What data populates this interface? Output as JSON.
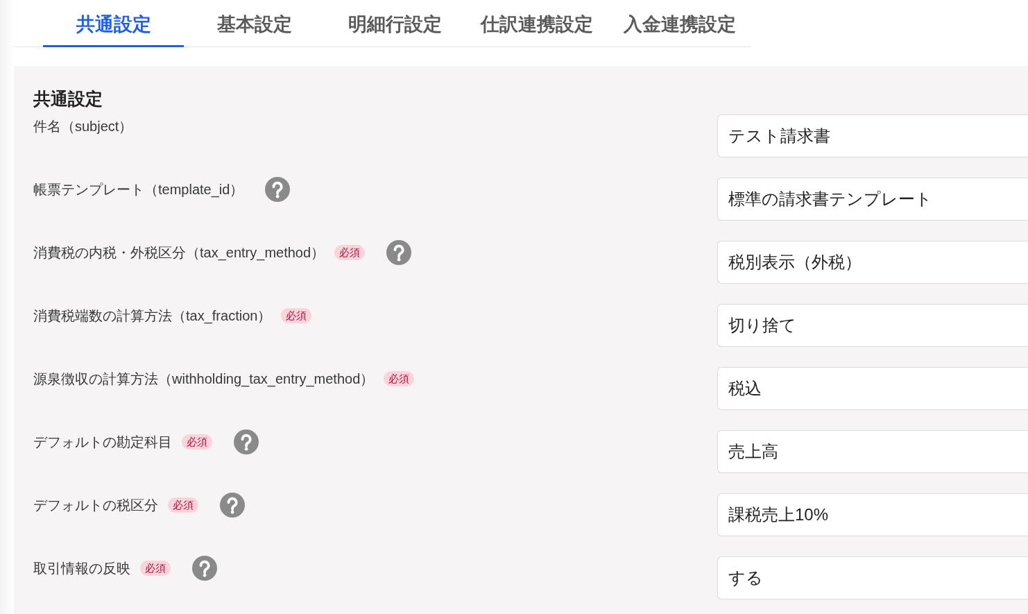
{
  "tabs": [
    {
      "label": "共通設定",
      "selected": true
    },
    {
      "label": "基本設定",
      "selected": false
    },
    {
      "label": "明細行設定",
      "selected": false
    },
    {
      "label": "仕訳連携設定",
      "selected": false
    },
    {
      "label": "入金連携設定",
      "selected": false
    }
  ],
  "section": {
    "title": "共通設定",
    "fields": [
      {
        "label": "件名（subject）",
        "help": false,
        "value": "テスト請求書"
      },
      {
        "label": "帳票テンプレート（template_id）",
        "help": true,
        "value": "標準の請求書テンプレート"
      },
      {
        "label": "消費税の内税・外税区分（tax_entry_method）",
        "required_tag": "必須",
        "help": true,
        "value": "税別表示（外税）"
      },
      {
        "label": "消費税端数の計算方法（tax_fraction）",
        "required_tag": "必須",
        "help": false,
        "value": "切り捨て"
      },
      {
        "label": "源泉徴収の計算方法（withholding_tax_entry_method）",
        "required_tag": "必須",
        "help": false,
        "value": "税込"
      },
      {
        "label": "デフォルトの勘定科目",
        "required_tag": "必須",
        "help": true,
        "value": "売上高"
      },
      {
        "label": "デフォルトの税区分",
        "required_tag": "必須",
        "help": true,
        "value": "課税売上10%"
      },
      {
        "label": "取引情報の反映",
        "required_tag": "必須",
        "help": true,
        "value": "する"
      }
    ]
  }
}
